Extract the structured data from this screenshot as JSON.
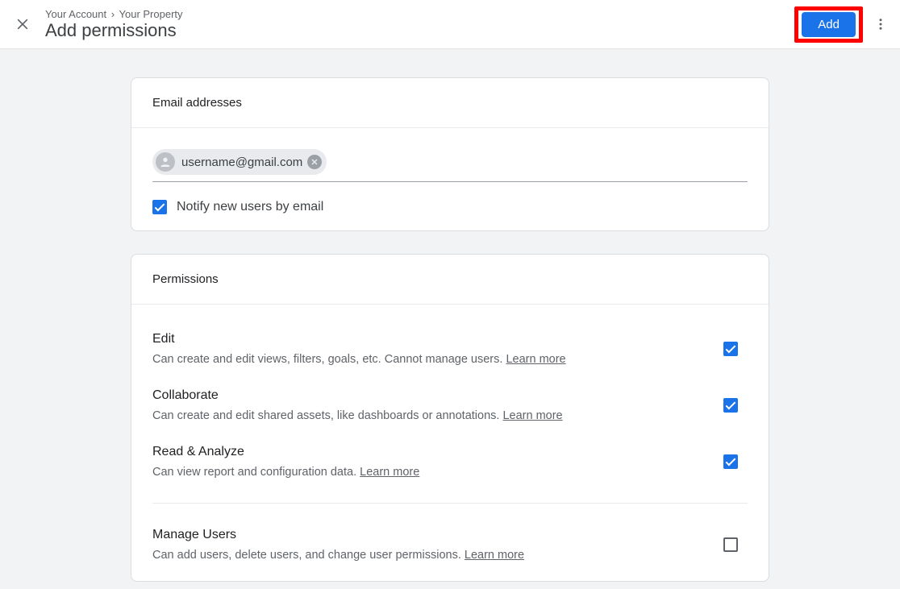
{
  "header": {
    "breadcrumb": {
      "account": "Your Account",
      "property": "Your Property"
    },
    "title": "Add permissions",
    "add_label": "Add"
  },
  "email_section": {
    "heading": "Email addresses",
    "chip_email": "username@gmail.com",
    "notify_label": "Notify new users by email",
    "notify_checked": true
  },
  "permissions_section": {
    "heading": "Permissions",
    "learn_more_label": "Learn more",
    "items": [
      {
        "title": "Edit",
        "desc": "Can create and edit views, filters, goals, etc. Cannot manage users.",
        "checked": true
      },
      {
        "title": "Collaborate",
        "desc": "Can create and edit shared assets, like dashboards or annotations.",
        "checked": true
      },
      {
        "title": "Read & Analyze",
        "desc": "Can view report and configuration data.",
        "checked": true
      },
      {
        "title": "Manage Users",
        "desc": "Can add users, delete users, and change user permissions.",
        "checked": false
      }
    ]
  }
}
